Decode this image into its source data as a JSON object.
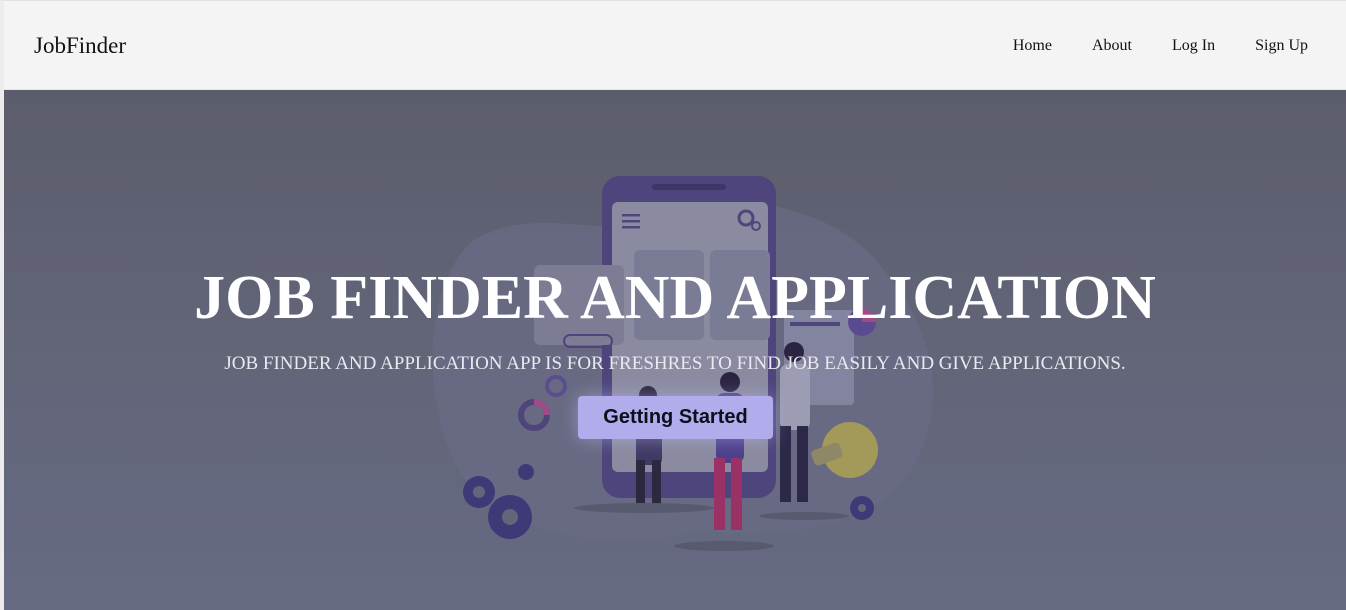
{
  "navbar": {
    "brand": "JobFinder",
    "links": [
      {
        "label": "Home"
      },
      {
        "label": "About"
      },
      {
        "label": "Log In"
      },
      {
        "label": "Sign Up"
      }
    ]
  },
  "hero": {
    "title": "JOB FINDER AND APPLICATION",
    "subtitle": "JOB FINDER AND APPLICATION APP IS FOR FRESHRES TO FIND JOB EASILY AND GIVE APPLICATIONS.",
    "cta_label": "Getting Started",
    "illustration": "people-using-job-app-illustration"
  },
  "colors": {
    "navbar_bg": "#f4f4f4",
    "hero_overlay": "#5e6173",
    "cta_bg": "#b1acec",
    "title_text": "#ffffff"
  }
}
